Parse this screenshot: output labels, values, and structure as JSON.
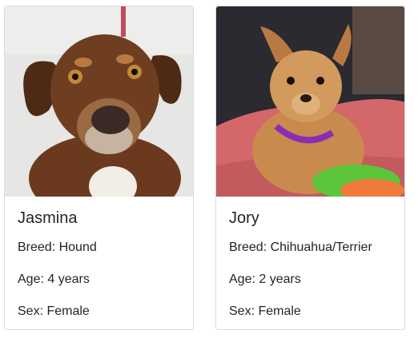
{
  "pets": [
    {
      "name": "Jasmina",
      "breed": "Breed: Hound",
      "age": "Age: 4 years",
      "sex": "Sex: Female",
      "photo_icon": "dog-photo-hound"
    },
    {
      "name": "Jory",
      "breed": "Breed: Chihuahua/Terrier",
      "age": "Age: 2 years",
      "sex": "Sex: Female",
      "photo_icon": "dog-photo-chihuahua-terrier"
    }
  ],
  "colors": {
    "text": "#212529",
    "card_border": "#dcdcdc",
    "hound_fur": "#6b3a1e",
    "terrier_fur": "#c98a4e",
    "collar": "#8e2bb3"
  }
}
